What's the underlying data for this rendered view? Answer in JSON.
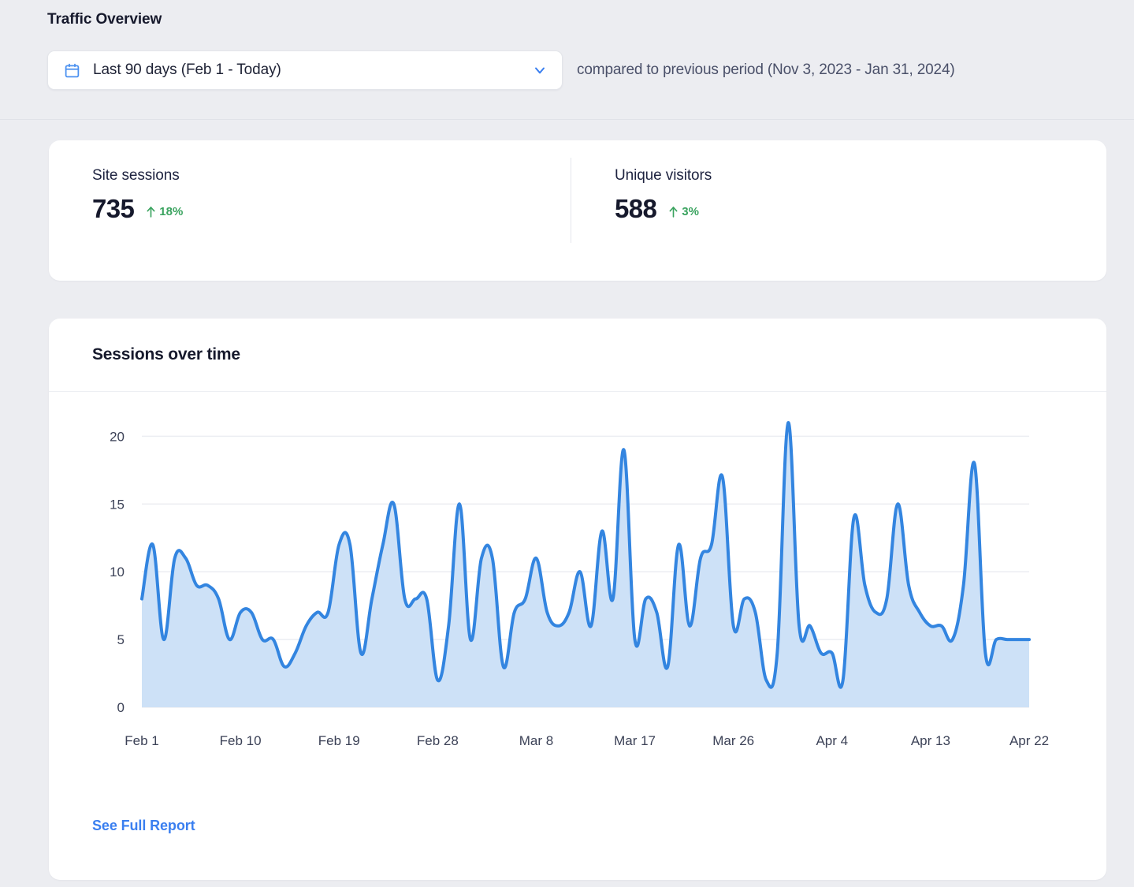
{
  "header": {
    "title": "Traffic Overview",
    "date_picker": {
      "icon": "calendar-icon",
      "value": "Last 90 days (Feb 1 - Today)",
      "chevron": "chevron-down-icon"
    },
    "comparison_text": "compared to previous period (Nov 3, 2023 - Jan 31, 2024)"
  },
  "stats": [
    {
      "label": "Site sessions",
      "value": "735",
      "delta": "18%",
      "direction": "up",
      "delta_color": "#3aa35f"
    },
    {
      "label": "Unique visitors",
      "value": "588",
      "delta": "3%",
      "direction": "up",
      "delta_color": "#3aa35f"
    }
  ],
  "chart_card": {
    "title": "Sessions over time",
    "link_label": "See Full Report"
  },
  "colors": {
    "page_background": "#ecedf1",
    "card_background": "#ffffff",
    "line": "#3385e0",
    "area_fill": "#cde1f7",
    "link": "#3a7ff0",
    "positive": "#3aa35f",
    "text_primary": "#16192c",
    "gridline": "#eceef2"
  },
  "chart_data": {
    "type": "area",
    "title": "Sessions over time",
    "xlabel": "",
    "ylabel": "",
    "ylim": [
      0,
      22
    ],
    "yticks": [
      0,
      5,
      10,
      15,
      20
    ],
    "grid": true,
    "legend": "none",
    "xtick_labels": [
      "Feb 1",
      "Feb 10",
      "Feb 19",
      "Feb 28",
      "Mar 8",
      "Mar 17",
      "Mar 26",
      "Apr 4",
      "Apr 13",
      "Apr 22"
    ],
    "xtick_indices": [
      0,
      9,
      18,
      27,
      36,
      45,
      54,
      63,
      72,
      81
    ],
    "series": [
      {
        "name": "Sessions",
        "values": [
          8,
          12,
          5,
          11,
          11,
          9,
          9,
          8,
          5,
          7,
          7,
          5,
          5,
          3,
          4,
          6,
          7,
          7,
          12,
          12,
          4,
          8,
          12,
          15,
          8,
          8,
          8,
          2,
          6,
          15,
          5,
          11,
          11,
          3,
          7,
          8,
          11,
          7,
          6,
          7,
          10,
          6,
          13,
          8,
          19,
          5,
          8,
          7,
          3,
          12,
          6,
          11,
          12,
          17,
          6,
          8,
          7,
          2,
          4,
          21,
          6,
          6,
          4,
          4,
          2,
          14,
          9,
          7,
          8,
          15,
          9,
          7,
          6,
          6,
          5,
          9,
          18,
          4,
          5,
          5,
          5,
          5
        ]
      }
    ]
  }
}
